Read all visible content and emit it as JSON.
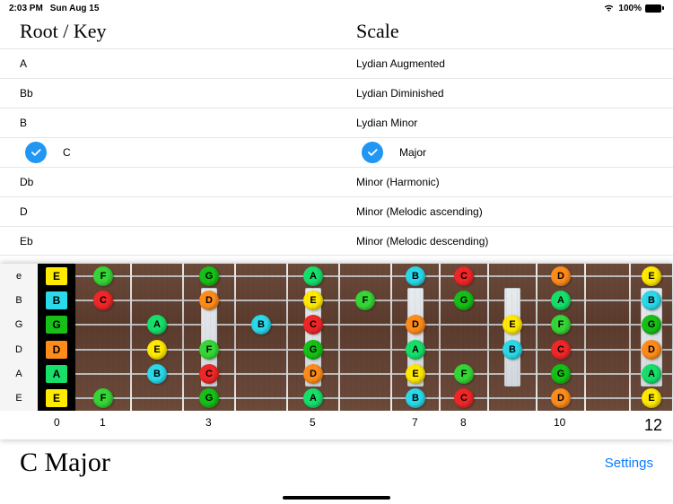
{
  "status": {
    "time": "2:03 PM",
    "date": "Sun Aug 15",
    "battery": "100%"
  },
  "headers": {
    "root": "Root / Key",
    "scale": "Scale"
  },
  "roots": [
    {
      "label": "A",
      "selected": false
    },
    {
      "label": "Bb",
      "selected": false
    },
    {
      "label": "B",
      "selected": false
    },
    {
      "label": "C",
      "selected": true
    },
    {
      "label": "Db",
      "selected": false
    },
    {
      "label": "D",
      "selected": false
    },
    {
      "label": "Eb",
      "selected": false
    }
  ],
  "scales": [
    {
      "label": "Lydian Augmented",
      "selected": false
    },
    {
      "label": "Lydian Diminished",
      "selected": false
    },
    {
      "label": "Lydian Minor",
      "selected": false
    },
    {
      "label": "Major",
      "selected": true
    },
    {
      "label": "Minor (Harmonic)",
      "selected": false
    },
    {
      "label": "Minor (Melodic ascending)",
      "selected": false
    },
    {
      "label": "Minor (Melodic descending)",
      "selected": false
    }
  ],
  "fretboard": {
    "open_strings": [
      "e",
      "B",
      "G",
      "D",
      "A",
      "E"
    ],
    "nut_notes": [
      "E",
      "B",
      "G",
      "D",
      "A",
      "E"
    ],
    "fret_count": 12,
    "fret_labels": {
      "0": "0",
      "1": "1",
      "3": "3",
      "5": "5",
      "7": "7",
      "8": "8",
      "10": "10",
      "12": "12"
    },
    "inlays": [
      3,
      5,
      7,
      9,
      12
    ],
    "note_colors": {
      "C": "#f02727",
      "D": "#ff8c1a",
      "E": "#ffea00",
      "F": "#36d636",
      "G": "#16c016",
      "A": "#16e06a",
      "B": "#2ad9ea"
    },
    "notes": [
      {
        "string": 0,
        "fret": 1,
        "n": "F"
      },
      {
        "string": 0,
        "fret": 3,
        "n": "G"
      },
      {
        "string": 0,
        "fret": 5,
        "n": "A"
      },
      {
        "string": 0,
        "fret": 7,
        "n": "B"
      },
      {
        "string": 0,
        "fret": 8,
        "n": "C"
      },
      {
        "string": 0,
        "fret": 10,
        "n": "D"
      },
      {
        "string": 0,
        "fret": 12,
        "n": "E"
      },
      {
        "string": 1,
        "fret": 1,
        "n": "C"
      },
      {
        "string": 1,
        "fret": 3,
        "n": "D"
      },
      {
        "string": 1,
        "fret": 5,
        "n": "E"
      },
      {
        "string": 1,
        "fret": 6,
        "n": "F"
      },
      {
        "string": 1,
        "fret": 8,
        "n": "G"
      },
      {
        "string": 1,
        "fret": 10,
        "n": "A"
      },
      {
        "string": 1,
        "fret": 12,
        "n": "B"
      },
      {
        "string": 2,
        "fret": 2,
        "n": "A"
      },
      {
        "string": 2,
        "fret": 4,
        "n": "B"
      },
      {
        "string": 2,
        "fret": 5,
        "n": "C"
      },
      {
        "string": 2,
        "fret": 7,
        "n": "D"
      },
      {
        "string": 2,
        "fret": 9,
        "n": "E"
      },
      {
        "string": 2,
        "fret": 10,
        "n": "F"
      },
      {
        "string": 2,
        "fret": 12,
        "n": "G"
      },
      {
        "string": 3,
        "fret": 2,
        "n": "E"
      },
      {
        "string": 3,
        "fret": 3,
        "n": "F"
      },
      {
        "string": 3,
        "fret": 5,
        "n": "G"
      },
      {
        "string": 3,
        "fret": 7,
        "n": "A"
      },
      {
        "string": 3,
        "fret": 9,
        "n": "B"
      },
      {
        "string": 3,
        "fret": 10,
        "n": "C"
      },
      {
        "string": 3,
        "fret": 12,
        "n": "D"
      },
      {
        "string": 4,
        "fret": 2,
        "n": "B"
      },
      {
        "string": 4,
        "fret": 3,
        "n": "C"
      },
      {
        "string": 4,
        "fret": 5,
        "n": "D"
      },
      {
        "string": 4,
        "fret": 7,
        "n": "E"
      },
      {
        "string": 4,
        "fret": 8,
        "n": "F"
      },
      {
        "string": 4,
        "fret": 10,
        "n": "G"
      },
      {
        "string": 4,
        "fret": 12,
        "n": "A"
      },
      {
        "string": 5,
        "fret": 1,
        "n": "F"
      },
      {
        "string": 5,
        "fret": 3,
        "n": "G"
      },
      {
        "string": 5,
        "fret": 5,
        "n": "A"
      },
      {
        "string": 5,
        "fret": 7,
        "n": "B"
      },
      {
        "string": 5,
        "fret": 8,
        "n": "C"
      },
      {
        "string": 5,
        "fret": 10,
        "n": "D"
      },
      {
        "string": 5,
        "fret": 12,
        "n": "E"
      }
    ]
  },
  "footer": {
    "title": "C Major",
    "settings": "Settings"
  }
}
